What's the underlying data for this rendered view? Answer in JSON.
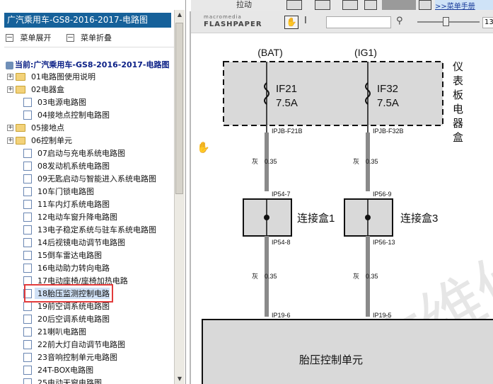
{
  "topstrip": {
    "label": "拉动",
    "link": ">>菜单手册"
  },
  "left_panel": {
    "title": "广汽乘用车-GS8-2016-2017-电路图",
    "expand_label": "菜单展开",
    "collapse_label": "菜单折叠",
    "current_label": "当前:广汽乘用车-GS8-2016-2017-电路图",
    "items": [
      {
        "num": "01",
        "label": "电路图使用说明",
        "type": "folder",
        "expand": "+"
      },
      {
        "num": "02",
        "label": "电器盒",
        "type": "folder",
        "expand": "+"
      },
      {
        "num": "03",
        "label": "电源电路图",
        "type": "doc",
        "expand": ""
      },
      {
        "num": "04",
        "label": "接地点控制电路图",
        "type": "doc",
        "expand": ""
      },
      {
        "num": "05",
        "label": "接地点",
        "type": "folder",
        "expand": "+"
      },
      {
        "num": "06",
        "label": "控制单元",
        "type": "folder",
        "expand": "+"
      },
      {
        "num": "07",
        "label": "启动与充电系统电路图",
        "type": "doc",
        "expand": ""
      },
      {
        "num": "08",
        "label": "发动机系统电路图",
        "type": "doc",
        "expand": ""
      },
      {
        "num": "09",
        "label": "无匙启动与智能进入系统电路图",
        "type": "doc",
        "expand": ""
      },
      {
        "num": "10",
        "label": "车门锁电路图",
        "type": "doc",
        "expand": ""
      },
      {
        "num": "11",
        "label": "车内灯系统电路图",
        "type": "doc",
        "expand": ""
      },
      {
        "num": "12",
        "label": "电动车窗升降电路图",
        "type": "doc",
        "expand": ""
      },
      {
        "num": "13",
        "label": "电子稳定系统与驻车系统电路图",
        "type": "doc",
        "expand": ""
      },
      {
        "num": "14",
        "label": "后视镜电动调节电路图",
        "type": "doc",
        "expand": ""
      },
      {
        "num": "15",
        "label": "倒车雷达电路图",
        "type": "doc",
        "expand": ""
      },
      {
        "num": "16",
        "label": "电动助力转向电路",
        "type": "doc",
        "expand": ""
      },
      {
        "num": "17",
        "label": "电动座椅/座椅加热电路",
        "type": "doc",
        "expand": ""
      },
      {
        "num": "18",
        "label": "胎压监测控制电路",
        "type": "doc",
        "expand": "",
        "selected": true
      },
      {
        "num": "19",
        "label": "前空调系统电路图",
        "type": "doc",
        "expand": ""
      },
      {
        "num": "20",
        "label": "后空调系统电路图",
        "type": "doc",
        "expand": ""
      },
      {
        "num": "21",
        "label": "喇叭电路图",
        "type": "doc",
        "expand": ""
      },
      {
        "num": "22",
        "label": "前大灯自动调节电路图",
        "type": "doc",
        "expand": ""
      },
      {
        "num": "23",
        "label": "音响控制单元电路图",
        "type": "doc",
        "expand": ""
      },
      {
        "num": "24",
        "label": "T-BOX电路图",
        "type": "doc",
        "expand": ""
      },
      {
        "num": "25",
        "label": "电动天窗电路图",
        "type": "doc",
        "expand": ""
      }
    ]
  },
  "viewer_toolbar": {
    "logo_top": "macromedia",
    "logo_bottom": "FLASHPAPER",
    "zoom_value": "13"
  },
  "diagram": {
    "bat_label": "(BAT)",
    "ig1_label": "(IG1)",
    "fuse1_name": "IF21",
    "fuse1_amp": "7.5A",
    "fuse2_name": "IF32",
    "fuse2_amp": "7.5A",
    "box_label": [
      "仪",
      "表",
      "板",
      "电",
      "器",
      "盒"
    ],
    "pin1": "IPJB-F21B",
    "pin2": "IPJB-F32B",
    "wire1a": "灰",
    "wire1b": "0.35",
    "wire2a": "灰",
    "wire2b": "0.35",
    "conn1_top": "IP54-7",
    "conn2_top": "IP56-9",
    "junction1": "连接盒1",
    "junction2": "连接盒3",
    "conn1_bot": "IP54-8",
    "conn2_bot": "IP56-13",
    "wire3a": "灰",
    "wire3b": "0.35",
    "wire4a": "灰",
    "wire4b": "0.35",
    "pin3": "IP19-6",
    "pin4": "IP19-5",
    "unit_label": "胎压控制单元"
  }
}
